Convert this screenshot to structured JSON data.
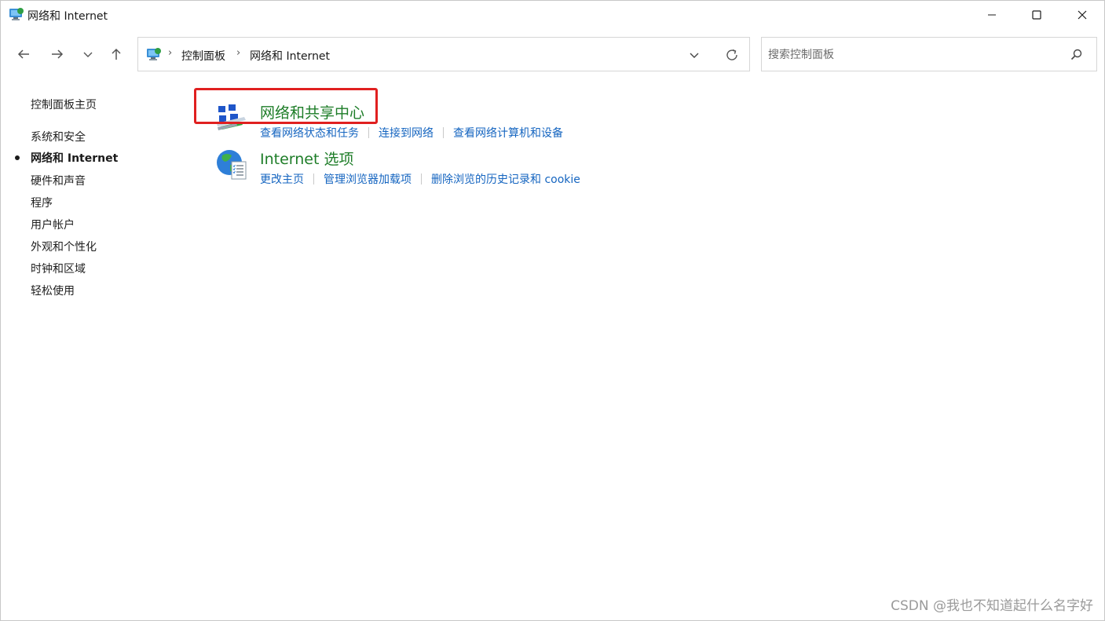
{
  "window": {
    "title": "网络和 Internet",
    "icon": "control-panel-network-icon"
  },
  "nav": {
    "back_icon": "arrow-left-icon",
    "forward_icon": "arrow-right-icon",
    "recent_icon": "chevron-down-icon",
    "up_icon": "arrow-up-icon"
  },
  "address": {
    "breadcrumbs": [
      "控制面板",
      "网络和 Internet"
    ],
    "separator": "›"
  },
  "search": {
    "placeholder": "搜索控制面板"
  },
  "sidebar": {
    "home": "控制面板主页",
    "items": [
      {
        "label": "系统和安全",
        "active": false
      },
      {
        "label": "网络和 Internet",
        "active": true
      },
      {
        "label": "硬件和声音",
        "active": false
      },
      {
        "label": "程序",
        "active": false
      },
      {
        "label": "用户帐户",
        "active": false
      },
      {
        "label": "外观和个性化",
        "active": false
      },
      {
        "label": "时钟和区域",
        "active": false
      },
      {
        "label": "轻松使用",
        "active": false
      }
    ]
  },
  "categories": [
    {
      "title": "网络和共享中心",
      "icon": "network-sharing-center-icon",
      "links": [
        "查看网络状态和任务",
        "连接到网络",
        "查看网络计算机和设备"
      ]
    },
    {
      "title": "Internet 选项",
      "icon": "internet-options-globe-icon",
      "links": [
        "更改主页",
        "管理浏览器加载项",
        "删除浏览的历史记录和 cookie"
      ]
    }
  ],
  "colors": {
    "category_title": "#1e7d28",
    "link": "#1565c0",
    "highlight": "#e02020"
  },
  "watermark": "CSDN @我也不知道起什么名字好"
}
